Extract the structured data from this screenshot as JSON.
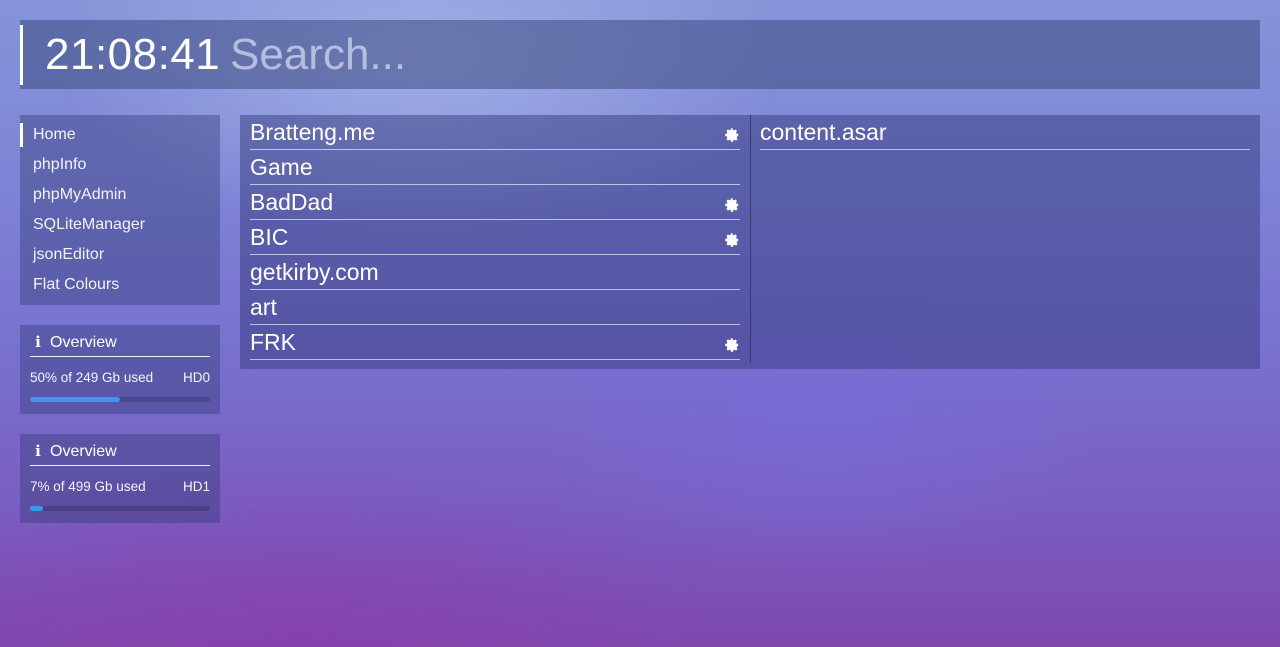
{
  "header": {
    "clock": "21:08:41",
    "search_placeholder": "Search..."
  },
  "nav": {
    "items": [
      {
        "label": "Home",
        "active": true
      },
      {
        "label": "phpInfo"
      },
      {
        "label": "phpMyAdmin"
      },
      {
        "label": "SQLiteManager"
      },
      {
        "label": "jsonEditor"
      },
      {
        "label": "Flat Colours"
      }
    ]
  },
  "overviews": [
    {
      "title": "Overview",
      "icon": "info-icon",
      "text": "50% of 249 Gb used",
      "disk": "HD0",
      "percent_used": 50
    },
    {
      "title": "Overview",
      "icon": "info-icon",
      "text": "7% of 499 Gb used",
      "disk": "HD1",
      "percent_used": 7
    }
  ],
  "projects": {
    "left": [
      {
        "label": "Bratteng.me",
        "settings": true
      },
      {
        "label": "Game",
        "settings": false
      },
      {
        "label": "BadDad",
        "settings": true
      },
      {
        "label": "BIC",
        "settings": true
      },
      {
        "label": "getkirby.com",
        "settings": false
      },
      {
        "label": "art",
        "settings": false
      },
      {
        "label": "FRK",
        "settings": true
      }
    ],
    "right": [
      {
        "label": "content.asar",
        "settings": false
      }
    ]
  },
  "colors": {
    "progress": "#3d97f0",
    "text": "#ffffff"
  }
}
